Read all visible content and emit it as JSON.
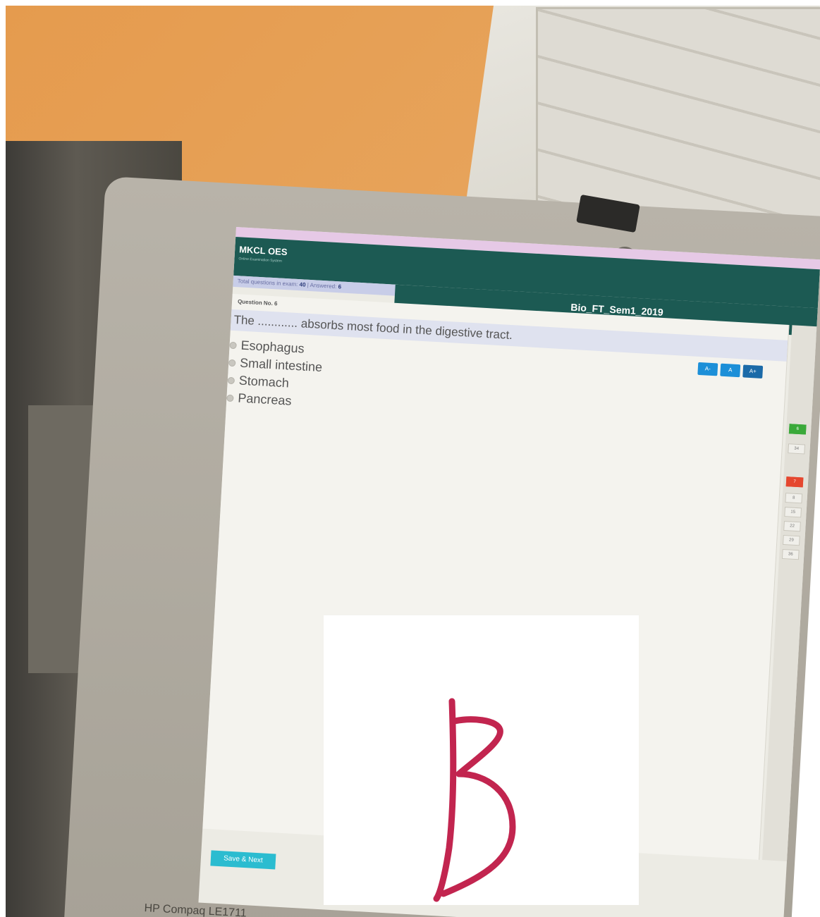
{
  "app": {
    "brand": "MKCL OES",
    "brand_subtitle": "Online Examination System"
  },
  "exam": {
    "title": "Bio_FT_Sem1_2019",
    "total_label": "Total questions in exam:",
    "total_value": "40",
    "answered_label": "| Answered:",
    "answered_value": "6"
  },
  "question": {
    "number_label": "Question No. 6",
    "text": "The ............ absorbs most food in the digestive tract.",
    "options": [
      {
        "label": "Esophagus"
      },
      {
        "label": "Small intestine"
      },
      {
        "label": "Stomach"
      },
      {
        "label": "Pancreas"
      }
    ]
  },
  "font_controls": [
    {
      "label": "A-"
    },
    {
      "label": "A"
    },
    {
      "label": "A+"
    }
  ],
  "actions": {
    "save_next": "Save & Next"
  },
  "navigator": {
    "numbers": [
      "8",
      "15",
      "22",
      "29",
      "36"
    ],
    "current": "7",
    "answered_marker": "6",
    "counter": "34"
  },
  "device": {
    "model_label": "HP Compaq LE1711"
  },
  "overlay": {
    "handwritten_answer": "B"
  },
  "colors": {
    "header": "#1c5a53",
    "accent_button": "#2bbcd0",
    "font_button": "#1c8fd8",
    "annotation": "#c2254f"
  }
}
